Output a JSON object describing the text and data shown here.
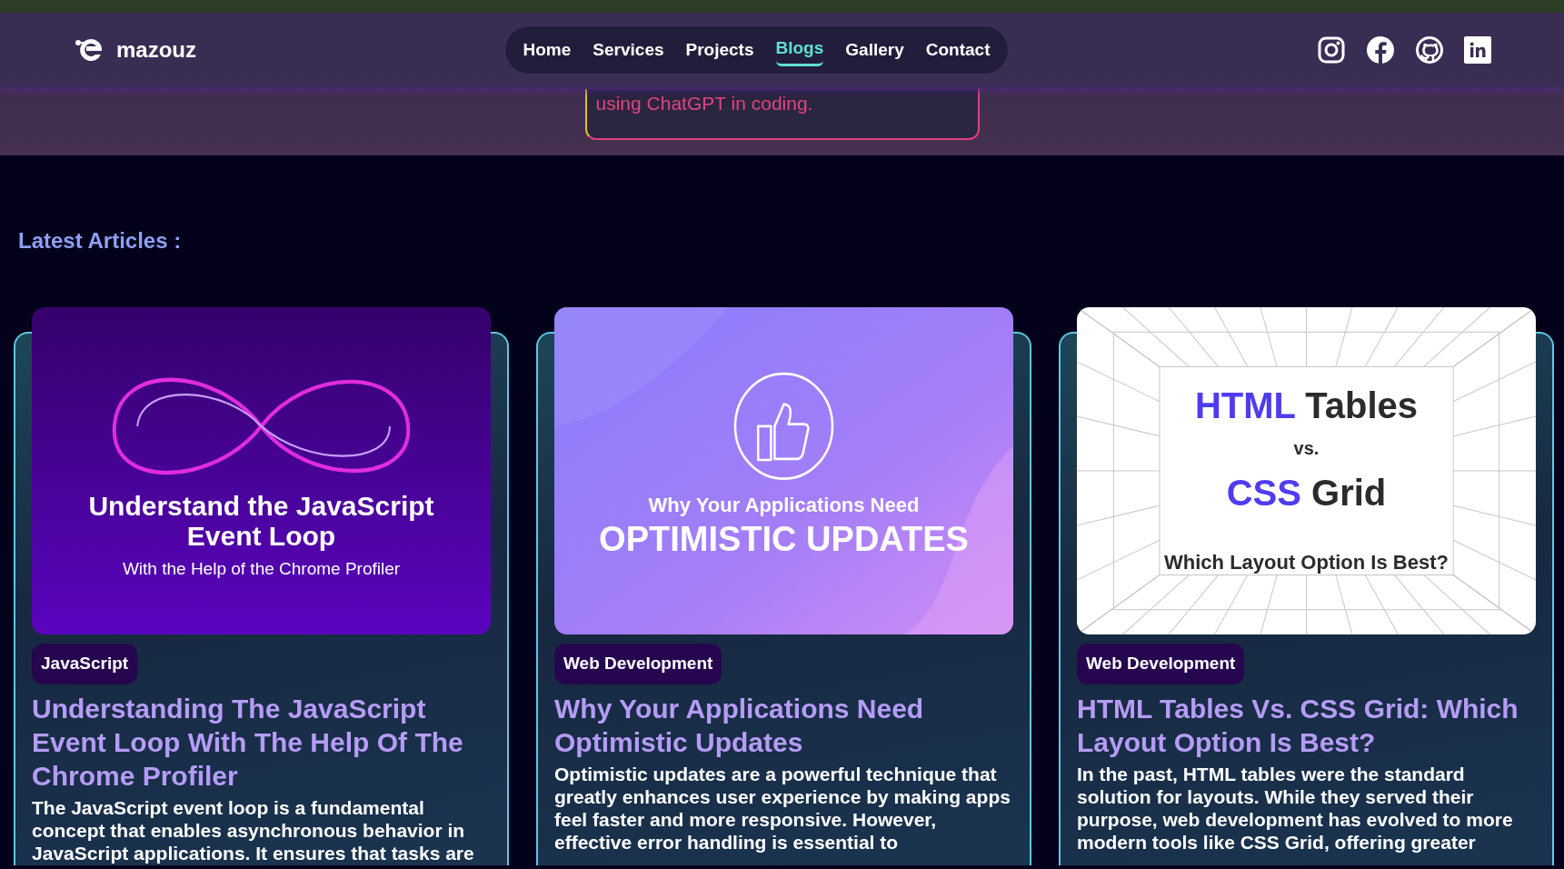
{
  "brand": {
    "name": "mazouz"
  },
  "nav": [
    {
      "label": "Home",
      "selected": false
    },
    {
      "label": "Services",
      "selected": false
    },
    {
      "label": "Projects",
      "selected": false
    },
    {
      "label": "Blogs",
      "selected": true
    },
    {
      "label": "Gallery",
      "selected": false
    },
    {
      "label": "Contact",
      "selected": false
    }
  ],
  "hero": {
    "text": "using ChatGPT in coding."
  },
  "section_title": "Latest Articles :",
  "articles": [
    {
      "cover": {
        "kind": "infinity",
        "heading": "Understand the JavaScript Event Loop",
        "subheading": "With the Help of the Chrome Profiler"
      },
      "tag": "JavaScript",
      "title": "Understanding The JavaScript Event Loop With The Help Of The Chrome Profiler",
      "excerpt": "The JavaScript event loop is a fundamental concept that enables asynchronous behavior in JavaScript applications. It ensures that tasks are"
    },
    {
      "cover": {
        "kind": "thumbs",
        "kicker": "Why Your Applications Need",
        "heading": "OPTIMISTIC UPDATES"
      },
      "tag": "Web Development",
      "title": "Why Your Applications Need Optimistic Updates",
      "excerpt": "Optimistic updates are a powerful technique that greatly enhances user experience by making apps feel faster and more responsive. However, effective error handling is essential to"
    },
    {
      "cover": {
        "kind": "grid",
        "lines": [
          {
            "accent": "HTML",
            "rest": "Tables"
          },
          {
            "accent": "CSS",
            "rest": "Grid"
          }
        ],
        "vs": "vs.",
        "question": "Which Layout Option Is Best?"
      },
      "tag": "Web Development",
      "title": "HTML Tables Vs. CSS Grid: Which Layout Option Is Best?",
      "excerpt": "In the past, HTML tables were the standard solution for layouts. While they served their purpose, web development has evolved to more modern tools like CSS Grid, offering greater"
    }
  ]
}
